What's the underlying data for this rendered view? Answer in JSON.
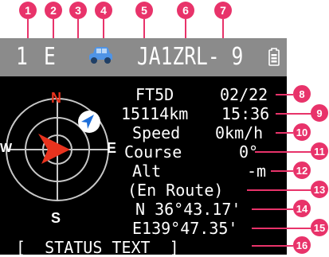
{
  "callouts": [
    "1",
    "2",
    "3",
    "4",
    "5",
    "6",
    "7",
    "8",
    "9",
    "10",
    "11",
    "12",
    "13",
    "14",
    "15",
    "16"
  ],
  "status_bar": {
    "memory_number": "1",
    "band_letter": "E",
    "station_icon": "car-icon",
    "callsign": "JA1ZRL- 9",
    "battery_icon": "battery-icon"
  },
  "compass": {
    "north": "N",
    "south": "S",
    "east": "E",
    "west": "W",
    "colors": {
      "north": "#e8331e",
      "arrow": "#e8331e",
      "ring": "#ffffff",
      "target": "#1e6fd9"
    }
  },
  "station": {
    "model": "FT5D",
    "date": "02/22",
    "distance": "15114km",
    "time": "15:36",
    "speed_label": "Speed",
    "speed_value": "0km/h",
    "course_label": "Course",
    "course_value": "0°",
    "alt_label": "Alt",
    "alt_value": "-m",
    "position_ambiguity": "(En Route)",
    "latitude": "N 36°43.17'",
    "longitude": "E139°47.35'",
    "status_text": "[  STATUS TEXT  ]"
  }
}
